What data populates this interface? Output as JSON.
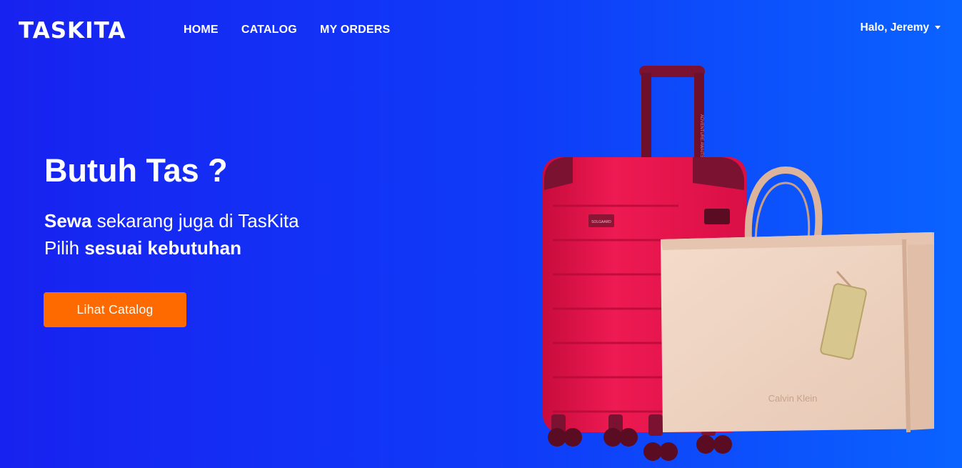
{
  "brand": {
    "logo_text": "TASKITA"
  },
  "nav": {
    "items": [
      {
        "label": "HOME"
      },
      {
        "label": "CATALOG"
      },
      {
        "label": "MY ORDERS"
      }
    ]
  },
  "user_menu": {
    "label": "Halo, Jeremy"
  },
  "hero": {
    "title": "Butuh Tas ?",
    "line1_bold": "Sewa",
    "line1_rest": " sekarang juga di TasKita",
    "line2_start": "Pilih ",
    "line2_bold": "sesuai kebutuhan",
    "cta_label": "Lihat Catalog"
  },
  "illustration": {
    "suitcase_color": "#e5124a",
    "suitcase_badge": "SOLGAARD",
    "suitcase_handle_text": "ADVENTURE AWAITS",
    "bag_color": "#efd4c2",
    "bag_brand": "Calvin Klein"
  },
  "colors": {
    "accent": "#ff6a00",
    "background_start": "#1822f0",
    "background_end": "#0a63ff"
  }
}
